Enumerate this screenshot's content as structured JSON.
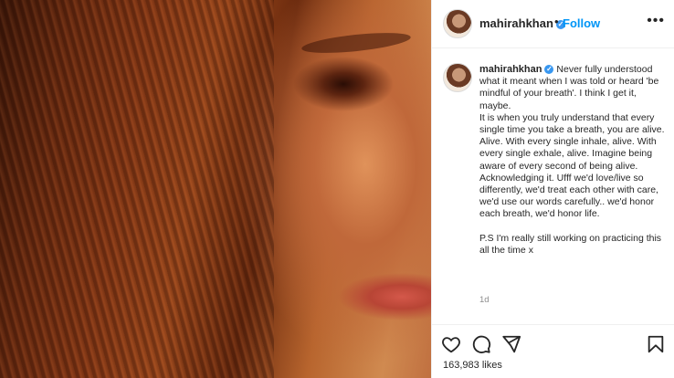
{
  "post": {
    "username": "mahirahkhan",
    "follow_label": "Follow",
    "more_label": "•••",
    "separator": "•",
    "caption_p1": "Never fully understood what it meant when I was told or heard 'be mindful of your breath'. I think I get it, maybe.",
    "caption_p2": "It is when you truly understand that every single time you take a breath, you are alive. Alive. With every single inhale, alive. With every single exhale, alive. Imagine being aware of every second of being alive. Acknowledging it. Ufff we'd love/live so differently, we'd treat each other with care, we'd use our words carefully.. we'd honor each breath, we'd honor life.",
    "caption_ps": "P.S I'm really still working on practicing this all the time x",
    "time": "1d",
    "likes": "163,983 likes"
  },
  "icons": [
    "heart-icon",
    "comment-icon",
    "share-icon",
    "bookmark-icon",
    "verified-badge-icon",
    "more-options-icon"
  ],
  "colors": {
    "accent": "#0095f6",
    "verified": "#3897f0",
    "muted": "#8e8e8e",
    "text": "#262626"
  }
}
